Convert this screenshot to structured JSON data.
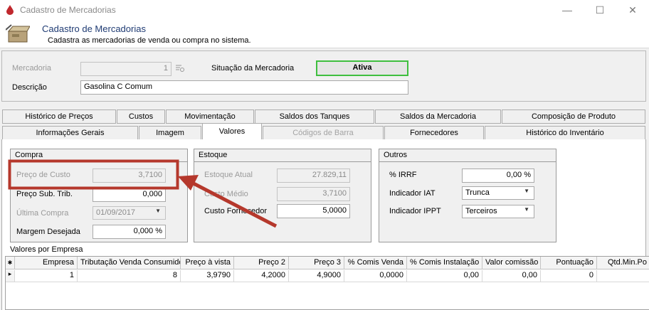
{
  "window": {
    "title": "Cadastro de Mercadorias",
    "minimize_glyph": "—",
    "maximize_glyph": "☐",
    "close_glyph": "✕"
  },
  "header": {
    "title": "Cadastro de Mercadorias",
    "subtitle": "Cadastra as mercadorias de venda ou compra no sistema."
  },
  "form": {
    "mercadoria_label": "Mercadoria",
    "mercadoria_value": "1",
    "situacao_label": "Situação da Mercadoria",
    "situacao_value": "Ativa",
    "descricao_label": "Descrição",
    "descricao_value": "Gasolina C Comum"
  },
  "tabs_row1": [
    "Histórico de Preços",
    "Custos",
    "Movimentação",
    "Saldos dos Tanques",
    "Saldos da Mercadoria",
    "Composição de Produto"
  ],
  "tabs_row2": [
    "Informações Gerais",
    "Imagem",
    "Valores",
    "Códigos de Barra",
    "Fornecedores",
    "Histórico do Inventário"
  ],
  "compra": {
    "title": "Compra",
    "preco_custo_label": "Preço de Custo",
    "preco_custo_value": "3,7100",
    "preco_sub_label": "Preço Sub. Trib.",
    "preco_sub_value": "0,000",
    "ultima_compra_label": "Última Compra",
    "ultima_compra_value": "01/09/2017",
    "margem_label": "Margem Desejada",
    "margem_value": "0,000 %"
  },
  "estoque": {
    "title": "Estoque",
    "atual_label": "Estoque Atual",
    "atual_value": "27.829,11",
    "medio_label": "Custo Médio",
    "medio_value": "3,7100",
    "fornecedor_label": "Custo Fornecedor",
    "fornecedor_value": "5,0000"
  },
  "outros": {
    "title": "Outros",
    "irrf_label": "% IRRF",
    "irrf_value": "0,00 %",
    "iat_label": "Indicador IAT",
    "iat_value": "Trunca",
    "ippt_label": "Indicador IPPT",
    "ippt_value": "Terceiros"
  },
  "grid": {
    "title": "Valores por Empresa",
    "headers": [
      "Empresa",
      "Tributação Venda Consumidor",
      "Preço à vista",
      "Preço 2",
      "Preço 3",
      "% Comis Venda",
      "% Comis Instalação",
      "Valor comissão",
      "Pontuação",
      "Qtd.Min.Po"
    ],
    "row": [
      "1",
      "8",
      "3,9790",
      "4,2000",
      "4,9000",
      "0,0000",
      "0,00",
      "0,00",
      "0",
      ""
    ]
  },
  "colors": {
    "highlight_box": "#b5382c",
    "status_border": "#3fbf3f",
    "header_title": "#1f3b73"
  }
}
